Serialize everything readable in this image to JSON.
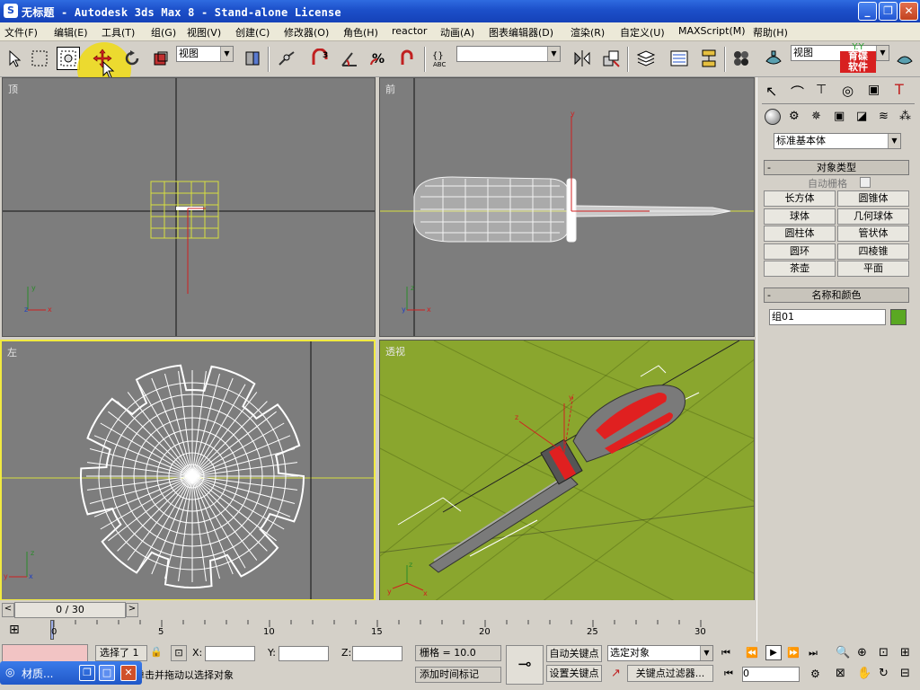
{
  "window": {
    "title": "无标题  - Autodesk 3ds Max 8  - Stand-alone License",
    "app_icon": "3ds-max-icon"
  },
  "menu": [
    "文件(F)",
    "编辑(E)",
    "工具(T)",
    "组(G)",
    "视图(V)",
    "创建(C)",
    "修改器(O)",
    "角色(H)",
    "reactor",
    "动画(A)",
    "图表编辑器(D)",
    "渲染(R)",
    "自定义(U)",
    "MAXScript(M)",
    "帮助(H)"
  ],
  "toolbar": {
    "view_combo": "视图",
    "view_combo_right": "视图",
    "named_selection": "",
    "logo_top": "育碟",
    "logo_bottom": "软件"
  },
  "viewports": {
    "top": "顶",
    "front": "前",
    "left": "左",
    "perspective": "透视"
  },
  "command_panel": {
    "category": "标准基本体",
    "rollout_object_type": "对象类型",
    "autogrid": "自动栅格",
    "primitives": [
      "长方体",
      "圆锥体",
      "球体",
      "几何球体",
      "圆柱体",
      "管状体",
      "圆环",
      "四棱锥",
      "茶壶",
      "平面"
    ],
    "rollout_name_color": "名称和颜色",
    "object_name": "组01",
    "object_color": "#5aa822"
  },
  "timeline": {
    "frame_display": "0 / 30",
    "ticks": [
      "0",
      "5",
      "10",
      "15",
      "20",
      "25",
      "30"
    ]
  },
  "status": {
    "selected": "选择了 1",
    "x_label": "X:",
    "y_label": "Y:",
    "z_label": "Z:",
    "grid": "栅格 = 10.0",
    "auto_key": "自动关键点",
    "set_key": "设置关键点",
    "selected_object": "选定对象",
    "key_filters": "关键点过滤器...",
    "prompt": "单击并拖动以选择对象",
    "add_time_tag": "添加时间标记",
    "current_frame": "0"
  },
  "taskbar": {
    "item": "材质..."
  }
}
